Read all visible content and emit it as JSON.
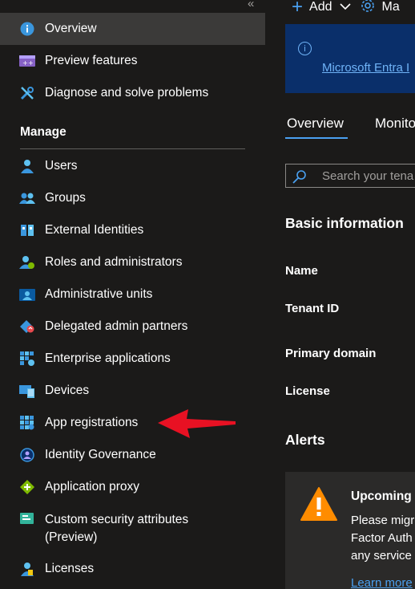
{
  "sidebar": {
    "collapse_glyph": "«",
    "manage_heading": "Manage",
    "items": [
      {
        "label": "Overview",
        "icon": "info-icon"
      },
      {
        "label": "Preview features",
        "icon": "preview-features-icon"
      },
      {
        "label": "Diagnose and solve problems",
        "icon": "wrench-icon"
      },
      {
        "label": "Users",
        "icon": "user-icon"
      },
      {
        "label": "Groups",
        "icon": "groups-icon"
      },
      {
        "label": "External Identities",
        "icon": "external-identities-icon"
      },
      {
        "label": "Roles and administrators",
        "icon": "roles-icon"
      },
      {
        "label": "Administrative units",
        "icon": "admin-units-icon"
      },
      {
        "label": "Delegated admin partners",
        "icon": "delegated-partners-icon"
      },
      {
        "label": "Enterprise applications",
        "icon": "enterprise-apps-icon"
      },
      {
        "label": "Devices",
        "icon": "devices-icon"
      },
      {
        "label": "App registrations",
        "icon": "app-registrations-icon"
      },
      {
        "label": "Identity Governance",
        "icon": "identity-governance-icon"
      },
      {
        "label": "Application proxy",
        "icon": "application-proxy-icon"
      },
      {
        "label": "Custom security attributes",
        "label2": "(Preview)",
        "icon": "custom-security-icon"
      },
      {
        "label": "Licenses",
        "icon": "licenses-icon"
      }
    ]
  },
  "toolbar": {
    "add_label": "Add",
    "manage_label": "Ma"
  },
  "banner": {
    "link_text": "Microsoft Entra I"
  },
  "tabs": [
    {
      "label": "Overview"
    },
    {
      "label": "Monito"
    }
  ],
  "search": {
    "placeholder": "Search your tena"
  },
  "basic_info": {
    "title": "Basic information",
    "fields": [
      "Name",
      "Tenant ID",
      "Primary domain",
      "License"
    ]
  },
  "alerts": {
    "title": "Alerts",
    "card": {
      "title": "Upcoming",
      "lines": [
        "Please migr",
        "Factor Auth",
        "any service"
      ],
      "link": "Learn more"
    }
  },
  "colors": {
    "accent": "#4aa0f0",
    "arrow": "#e81123",
    "banner": "#0a2f6a"
  }
}
